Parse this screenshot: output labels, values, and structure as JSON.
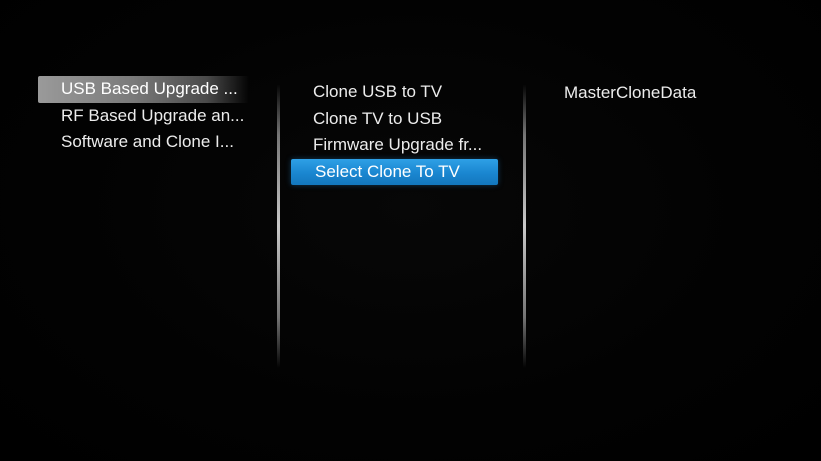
{
  "menu": {
    "column_1": {
      "items": [
        {
          "label": "USB Based Upgrade ...",
          "state": "current"
        },
        {
          "label": "RF Based Upgrade an...",
          "state": "normal"
        },
        {
          "label": "Software and Clone I...",
          "state": "normal"
        }
      ]
    },
    "column_2": {
      "items": [
        {
          "label": "Clone USB to TV",
          "state": "normal"
        },
        {
          "label": "Clone TV to USB",
          "state": "normal"
        },
        {
          "label": "Firmware Upgrade fr...",
          "state": "normal"
        },
        {
          "label": "Select Clone To TV",
          "state": "focused"
        }
      ]
    },
    "column_3": {
      "items": [
        {
          "label": "MasterCloneData",
          "state": "normal"
        }
      ]
    }
  },
  "colors": {
    "background": "#000000",
    "focus_highlight": "#1a86d0",
    "current_highlight": "#8a8a8a",
    "text": "#ececec"
  }
}
